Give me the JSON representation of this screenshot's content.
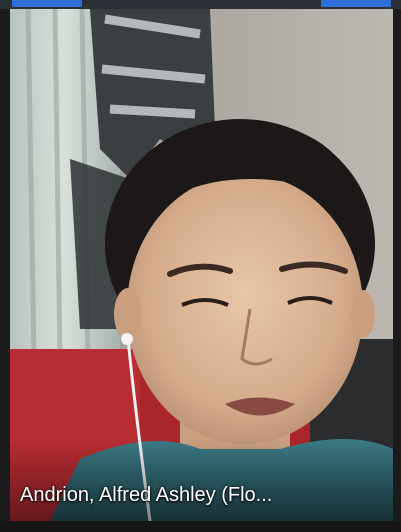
{
  "participant": {
    "display_name": "Andrion, Alfred Ashley (Flo..."
  },
  "colors": {
    "name_text": "#ffffff",
    "tile_background": "#1b1b1b",
    "active_speaker_accent": "#2d6fd6"
  }
}
